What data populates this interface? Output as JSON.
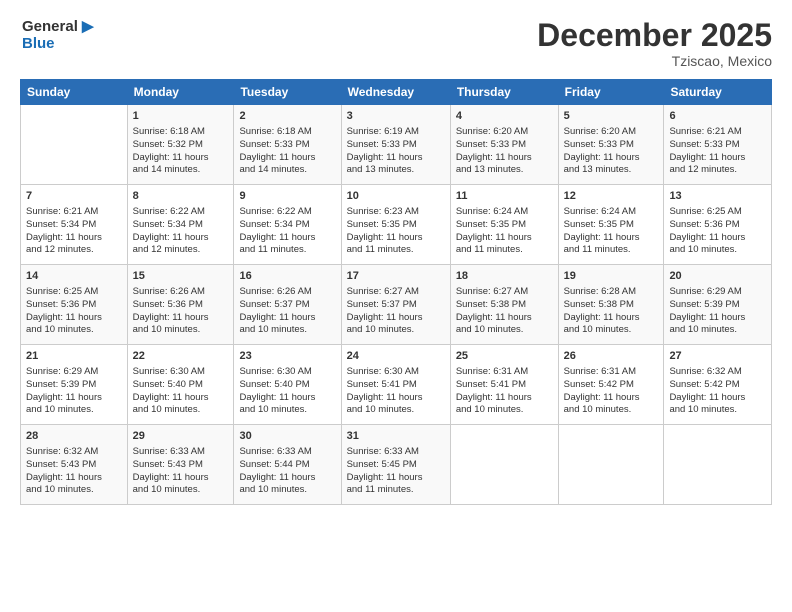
{
  "header": {
    "logo_line1": "General",
    "logo_line2": "Blue",
    "month": "December 2025",
    "location": "Tziscao, Mexico"
  },
  "weekdays": [
    "Sunday",
    "Monday",
    "Tuesday",
    "Wednesday",
    "Thursday",
    "Friday",
    "Saturday"
  ],
  "weeks": [
    [
      {
        "day": "",
        "info": ""
      },
      {
        "day": "1",
        "info": "Sunrise: 6:18 AM\nSunset: 5:32 PM\nDaylight: 11 hours\nand 14 minutes."
      },
      {
        "day": "2",
        "info": "Sunrise: 6:18 AM\nSunset: 5:33 PM\nDaylight: 11 hours\nand 14 minutes."
      },
      {
        "day": "3",
        "info": "Sunrise: 6:19 AM\nSunset: 5:33 PM\nDaylight: 11 hours\nand 13 minutes."
      },
      {
        "day": "4",
        "info": "Sunrise: 6:20 AM\nSunset: 5:33 PM\nDaylight: 11 hours\nand 13 minutes."
      },
      {
        "day": "5",
        "info": "Sunrise: 6:20 AM\nSunset: 5:33 PM\nDaylight: 11 hours\nand 13 minutes."
      },
      {
        "day": "6",
        "info": "Sunrise: 6:21 AM\nSunset: 5:33 PM\nDaylight: 11 hours\nand 12 minutes."
      }
    ],
    [
      {
        "day": "7",
        "info": "Sunrise: 6:21 AM\nSunset: 5:34 PM\nDaylight: 11 hours\nand 12 minutes."
      },
      {
        "day": "8",
        "info": "Sunrise: 6:22 AM\nSunset: 5:34 PM\nDaylight: 11 hours\nand 12 minutes."
      },
      {
        "day": "9",
        "info": "Sunrise: 6:22 AM\nSunset: 5:34 PM\nDaylight: 11 hours\nand 11 minutes."
      },
      {
        "day": "10",
        "info": "Sunrise: 6:23 AM\nSunset: 5:35 PM\nDaylight: 11 hours\nand 11 minutes."
      },
      {
        "day": "11",
        "info": "Sunrise: 6:24 AM\nSunset: 5:35 PM\nDaylight: 11 hours\nand 11 minutes."
      },
      {
        "day": "12",
        "info": "Sunrise: 6:24 AM\nSunset: 5:35 PM\nDaylight: 11 hours\nand 11 minutes."
      },
      {
        "day": "13",
        "info": "Sunrise: 6:25 AM\nSunset: 5:36 PM\nDaylight: 11 hours\nand 10 minutes."
      }
    ],
    [
      {
        "day": "14",
        "info": "Sunrise: 6:25 AM\nSunset: 5:36 PM\nDaylight: 11 hours\nand 10 minutes."
      },
      {
        "day": "15",
        "info": "Sunrise: 6:26 AM\nSunset: 5:36 PM\nDaylight: 11 hours\nand 10 minutes."
      },
      {
        "day": "16",
        "info": "Sunrise: 6:26 AM\nSunset: 5:37 PM\nDaylight: 11 hours\nand 10 minutes."
      },
      {
        "day": "17",
        "info": "Sunrise: 6:27 AM\nSunset: 5:37 PM\nDaylight: 11 hours\nand 10 minutes."
      },
      {
        "day": "18",
        "info": "Sunrise: 6:27 AM\nSunset: 5:38 PM\nDaylight: 11 hours\nand 10 minutes."
      },
      {
        "day": "19",
        "info": "Sunrise: 6:28 AM\nSunset: 5:38 PM\nDaylight: 11 hours\nand 10 minutes."
      },
      {
        "day": "20",
        "info": "Sunrise: 6:29 AM\nSunset: 5:39 PM\nDaylight: 11 hours\nand 10 minutes."
      }
    ],
    [
      {
        "day": "21",
        "info": "Sunrise: 6:29 AM\nSunset: 5:39 PM\nDaylight: 11 hours\nand 10 minutes."
      },
      {
        "day": "22",
        "info": "Sunrise: 6:30 AM\nSunset: 5:40 PM\nDaylight: 11 hours\nand 10 minutes."
      },
      {
        "day": "23",
        "info": "Sunrise: 6:30 AM\nSunset: 5:40 PM\nDaylight: 11 hours\nand 10 minutes."
      },
      {
        "day": "24",
        "info": "Sunrise: 6:30 AM\nSunset: 5:41 PM\nDaylight: 11 hours\nand 10 minutes."
      },
      {
        "day": "25",
        "info": "Sunrise: 6:31 AM\nSunset: 5:41 PM\nDaylight: 11 hours\nand 10 minutes."
      },
      {
        "day": "26",
        "info": "Sunrise: 6:31 AM\nSunset: 5:42 PM\nDaylight: 11 hours\nand 10 minutes."
      },
      {
        "day": "27",
        "info": "Sunrise: 6:32 AM\nSunset: 5:42 PM\nDaylight: 11 hours\nand 10 minutes."
      }
    ],
    [
      {
        "day": "28",
        "info": "Sunrise: 6:32 AM\nSunset: 5:43 PM\nDaylight: 11 hours\nand 10 minutes."
      },
      {
        "day": "29",
        "info": "Sunrise: 6:33 AM\nSunset: 5:43 PM\nDaylight: 11 hours\nand 10 minutes."
      },
      {
        "day": "30",
        "info": "Sunrise: 6:33 AM\nSunset: 5:44 PM\nDaylight: 11 hours\nand 10 minutes."
      },
      {
        "day": "31",
        "info": "Sunrise: 6:33 AM\nSunset: 5:45 PM\nDaylight: 11 hours\nand 11 minutes."
      },
      {
        "day": "",
        "info": ""
      },
      {
        "day": "",
        "info": ""
      },
      {
        "day": "",
        "info": ""
      }
    ]
  ]
}
